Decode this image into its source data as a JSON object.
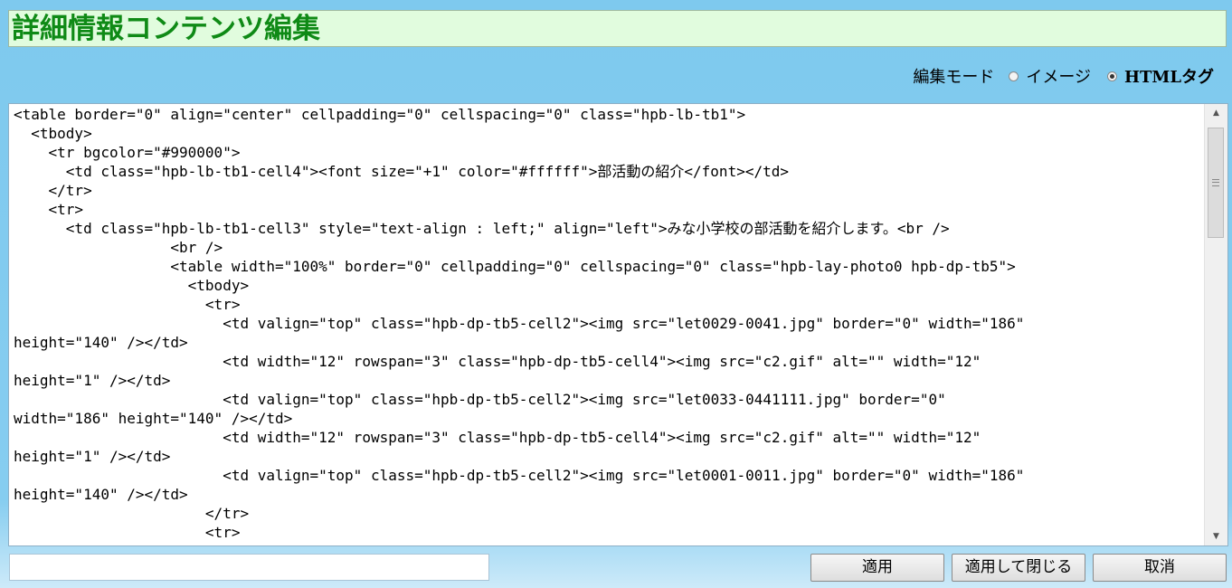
{
  "title": "詳細情報コンテンツ編集",
  "mode": {
    "label": "編集モード",
    "options": [
      {
        "label": "イメージ",
        "selected": false
      },
      {
        "label": "HTMLタグ",
        "selected": true
      }
    ]
  },
  "editor": {
    "content": "<table border=\"0\" align=\"center\" cellpadding=\"0\" cellspacing=\"0\" class=\"hpb-lb-tb1\">\n  <tbody>\n    <tr bgcolor=\"#990000\">\n      <td class=\"hpb-lb-tb1-cell4\"><font size=\"+1\" color=\"#ffffff\">部活動の紹介</font></td>\n    </tr>\n    <tr>\n      <td class=\"hpb-lb-tb1-cell3\" style=\"text-align : left;\" align=\"left\">みな小学校の部活動を紹介します。<br />\n                  <br />\n                  <table width=\"100%\" border=\"0\" cellpadding=\"0\" cellspacing=\"0\" class=\"hpb-lay-photo0 hpb-dp-tb5\">\n                    <tbody>\n                      <tr>\n                        <td valign=\"top\" class=\"hpb-dp-tb5-cell2\"><img src=\"let0029-0041.jpg\" border=\"0\" width=\"186\"\nheight=\"140\" /></td>\n                        <td width=\"12\" rowspan=\"3\" class=\"hpb-dp-tb5-cell4\"><img src=\"c2.gif\" alt=\"\" width=\"12\"\nheight=\"1\" /></td>\n                        <td valign=\"top\" class=\"hpb-dp-tb5-cell2\"><img src=\"let0033-0441111.jpg\" border=\"0\"\nwidth=\"186\" height=\"140\" /></td>\n                        <td width=\"12\" rowspan=\"3\" class=\"hpb-dp-tb5-cell4\"><img src=\"c2.gif\" alt=\"\" width=\"12\"\nheight=\"1\" /></td>\n                        <td valign=\"top\" class=\"hpb-dp-tb5-cell2\"><img src=\"let0001-0011.jpg\" border=\"0\" width=\"186\"\nheight=\"140\" /></td>\n                      </tr>\n                      <tr>"
  },
  "status_input": {
    "value": ""
  },
  "buttons": {
    "apply": "適用",
    "apply_close": "適用して閉じる",
    "cancel": "取消"
  },
  "colors": {
    "title_text": "#0f8a16",
    "title_bg": "#e1fcde",
    "page_bg": "#86cdf0"
  }
}
